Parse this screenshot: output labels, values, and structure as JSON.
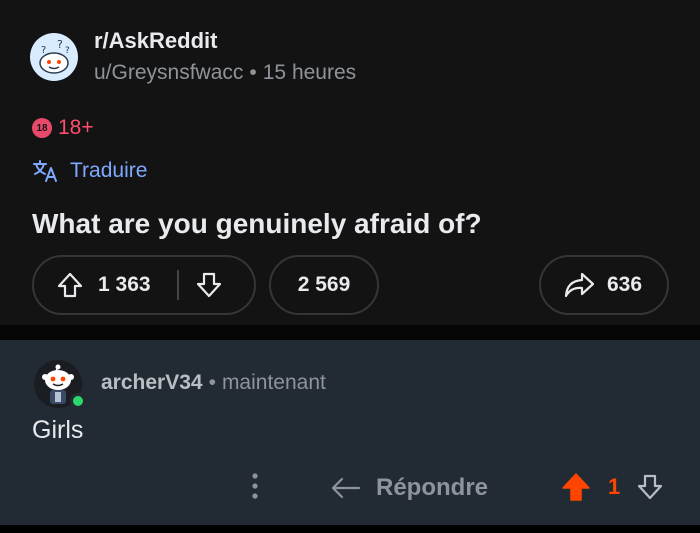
{
  "post": {
    "subreddit": "r/AskReddit",
    "author": "u/Greysnsfwacc",
    "separator": "•",
    "time": "15 heures",
    "nsfw_badge": "18",
    "nsfw_label": "18+",
    "translate_label": "Traduire",
    "title": "What are you genuinely afraid of?",
    "upvotes": "1 363",
    "comments": "2 569",
    "shares": "636"
  },
  "comment": {
    "author": "archerV34",
    "separator": "•",
    "time": "maintenant",
    "body": "Girls",
    "reply_label": "Répondre",
    "score": "1"
  },
  "colors": {
    "background": "#131314",
    "comment_background": "#222a33",
    "accent_upvote": "#ff4500",
    "nsfw": "#ff4d6d",
    "translate_link": "#7fa8ff",
    "online": "#2bd96b"
  },
  "icons": [
    "subreddit-avatar-icon",
    "nsfw-icon",
    "translate-icon",
    "upvote-icon",
    "downvote-icon",
    "share-icon",
    "user-avatar-icon",
    "more-options-icon",
    "reply-icon"
  ]
}
